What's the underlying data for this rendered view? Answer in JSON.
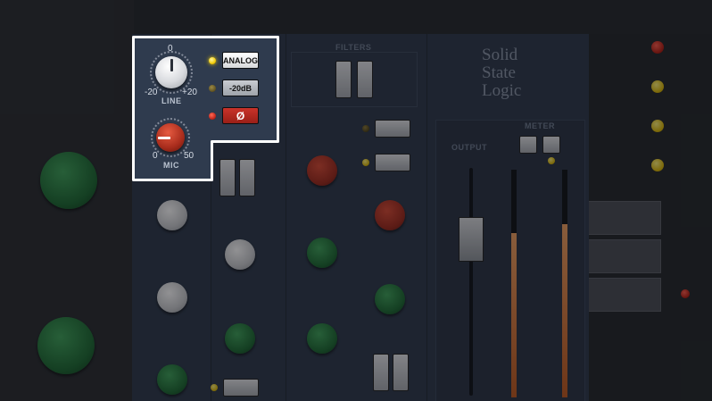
{
  "highlight_panel": {
    "line_knob": {
      "label": "LINE",
      "scale_top": "0",
      "scale_min": "-20",
      "scale_max": "+20"
    },
    "mic_knob": {
      "label": "MIC",
      "scale_min": "0",
      "scale_max": "50"
    },
    "buttons": {
      "analog": "ANALOG",
      "pad": "-20dB",
      "phase": "Ø"
    }
  },
  "background": {
    "brand": [
      "Solid",
      "State",
      "Logic"
    ],
    "labels": {
      "filters": "FILTERS",
      "output": "OUTPUT",
      "meter": "METER"
    }
  },
  "colors": {
    "panel": "#2e3a4c",
    "highlight_border": "#ffffff",
    "led_on": "#f0c800",
    "phase_red": "#c9332a"
  }
}
